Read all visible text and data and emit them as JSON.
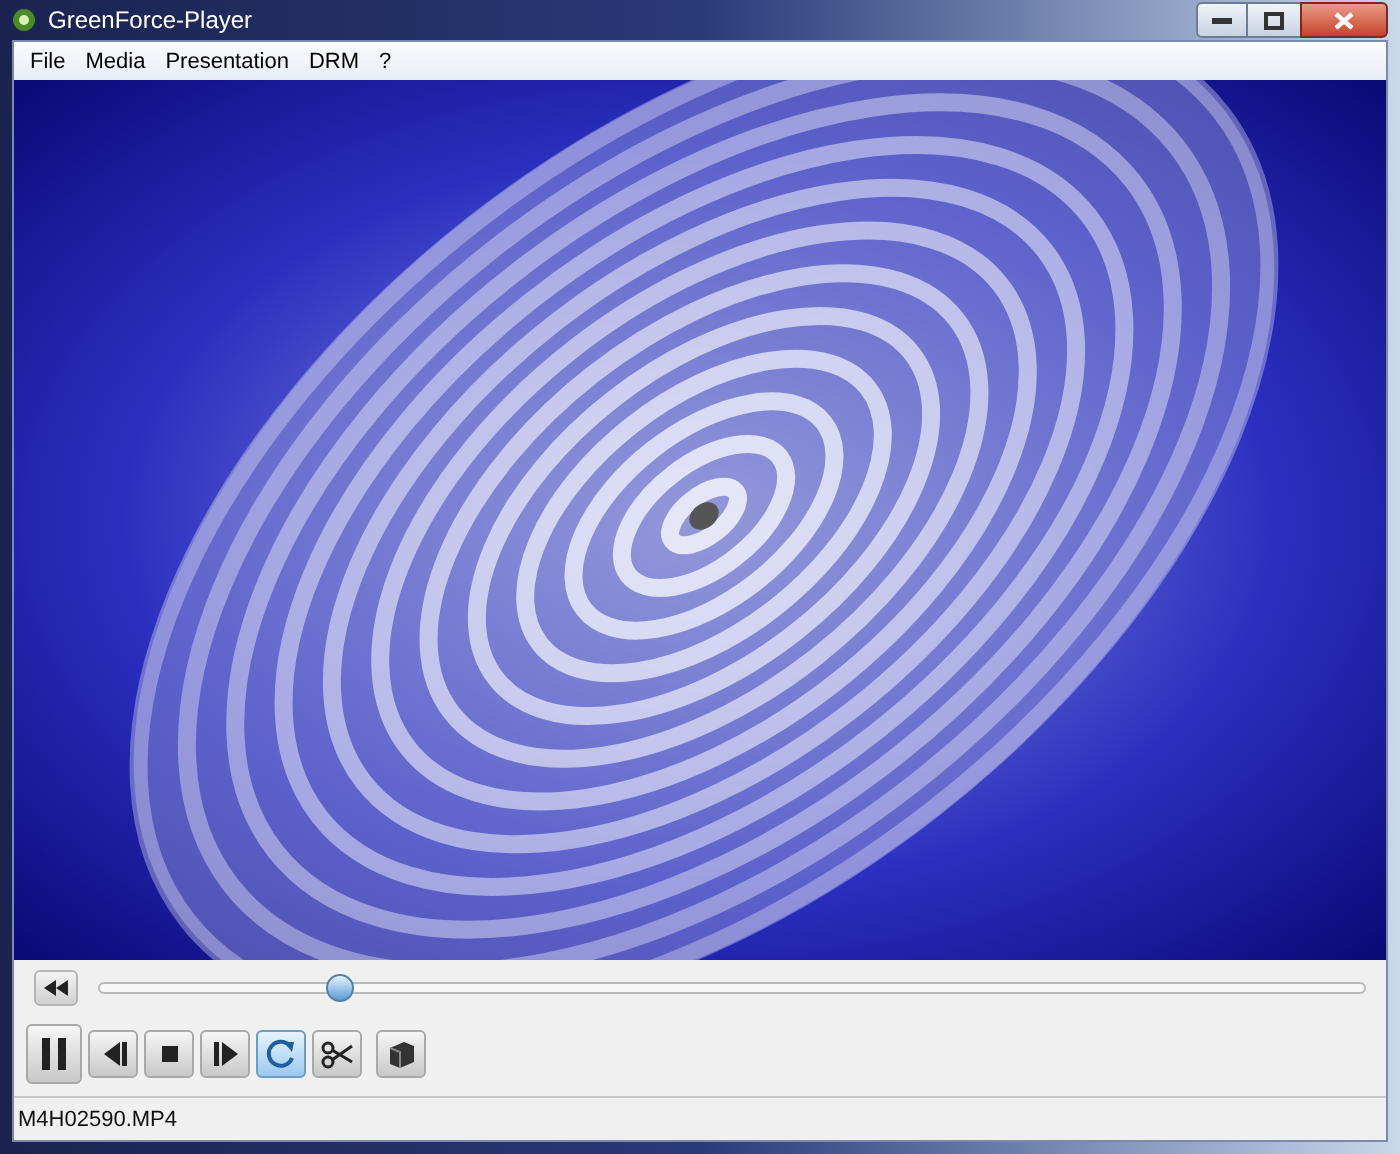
{
  "window": {
    "title": "GreenForce-Player"
  },
  "menu": [
    "File",
    "Media",
    "Presentation",
    "DRM",
    "?"
  ],
  "seek": {
    "level": 0.19
  },
  "controls": [
    {
      "kind": "pause",
      "on": false
    },
    {
      "kind": "step-back",
      "on": false
    },
    {
      "kind": "stop",
      "on": false
    },
    {
      "kind": "step-forward",
      "on": false
    },
    {
      "kind": "loop",
      "on": true
    },
    {
      "kind": "cut",
      "on": false
    },
    {
      "kind": "box",
      "on": false
    }
  ],
  "status_bar": {
    "file": "M4H02590.MP4"
  }
}
